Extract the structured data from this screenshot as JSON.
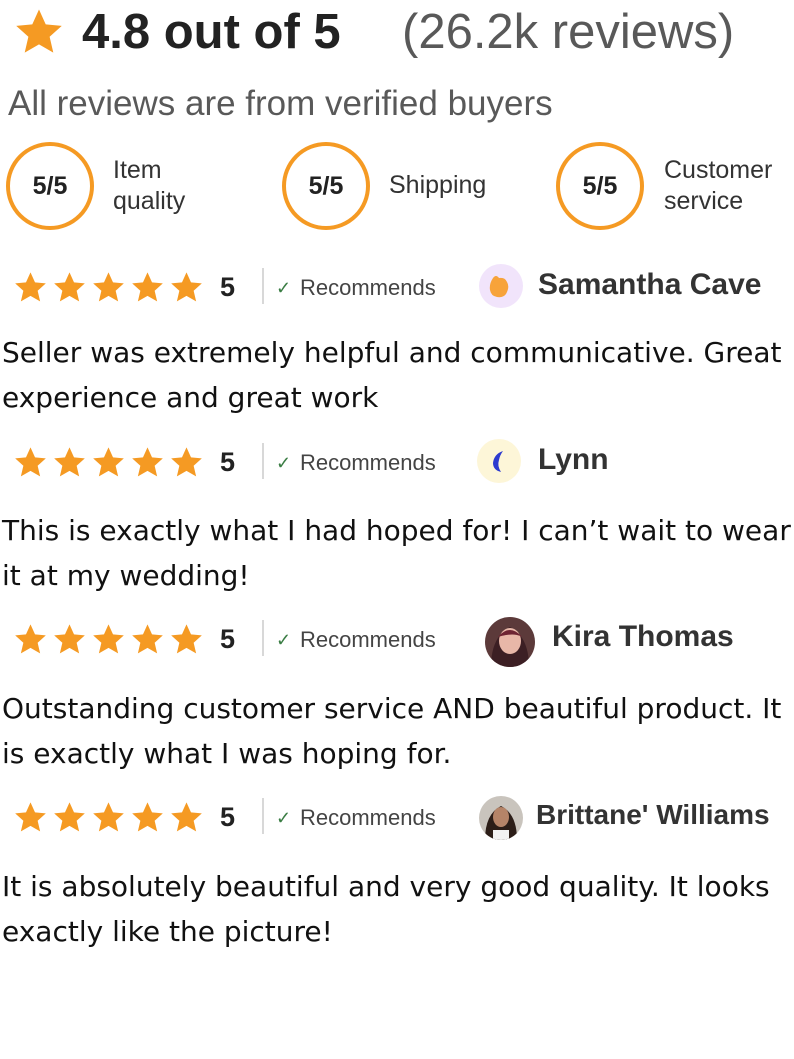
{
  "summary": {
    "rating_text": "4.8 out of 5",
    "review_count_text": "(26.2k reviews)",
    "verified_note": "All reviews are from verified buyers",
    "star_icon": "star-icon",
    "accent_color": "#f59a23"
  },
  "metrics": [
    {
      "score": "5/5",
      "label_line1": "Item",
      "label_line2": "quality"
    },
    {
      "score": "5/5",
      "label_line1": "Shipping",
      "label_line2": ""
    },
    {
      "score": "5/5",
      "label_line1": "Customer",
      "label_line2": "service"
    }
  ],
  "reviews": [
    {
      "rating": "5",
      "recommends_label": "Recommends",
      "reviewer": "Samantha Cave",
      "text": "Seller was extremely helpful and communicative. Great experience and great work"
    },
    {
      "rating": "5",
      "recommends_label": "Recommends",
      "reviewer": "Lynn",
      "text": "This is exactly what I had hoped for! I can’t wait to wear it at my wedding!"
    },
    {
      "rating": "5",
      "recommends_label": "Recommends",
      "reviewer": "Kira Thomas",
      "text": "Outstanding customer service AND beautiful product. It is exactly what I was hoping for."
    },
    {
      "rating": "5",
      "recommends_label": "Recommends",
      "reviewer": "Brittane' Williams",
      "text": "It is absolutely beautiful and very good quality. It looks exactly like the picture!"
    }
  ]
}
